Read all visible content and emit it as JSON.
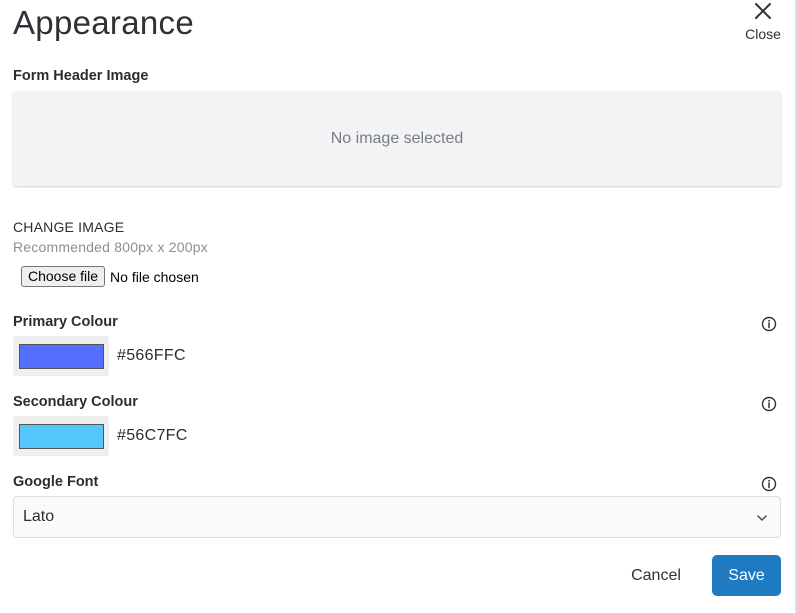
{
  "header": {
    "title": "Appearance",
    "close_label": "Close",
    "close_icon": "close-x-icon"
  },
  "header_image": {
    "label": "Form Header Image",
    "placeholder_text": "No image selected"
  },
  "change_image": {
    "label": "CHANGE IMAGE",
    "recommended": "Recommended 800px x 200px",
    "file_button_label": "Choose file",
    "file_status": "No file chosen"
  },
  "primary_colour": {
    "label": "Primary Colour",
    "hex": "#566FFC",
    "swatch_color": "#566FFC",
    "info_icon": "info-circle-icon"
  },
  "secondary_colour": {
    "label": "Secondary Colour",
    "hex": "#56C7FC",
    "swatch_color": "#56C7FC",
    "info_icon": "info-circle-icon"
  },
  "google_font": {
    "label": "Google Font",
    "selected": "Lato",
    "info_icon": "info-circle-icon",
    "dropdown_icon": "chevron-down-icon"
  },
  "actions": {
    "cancel_label": "Cancel",
    "save_label": "Save",
    "save_color": "#1F7BC1"
  }
}
